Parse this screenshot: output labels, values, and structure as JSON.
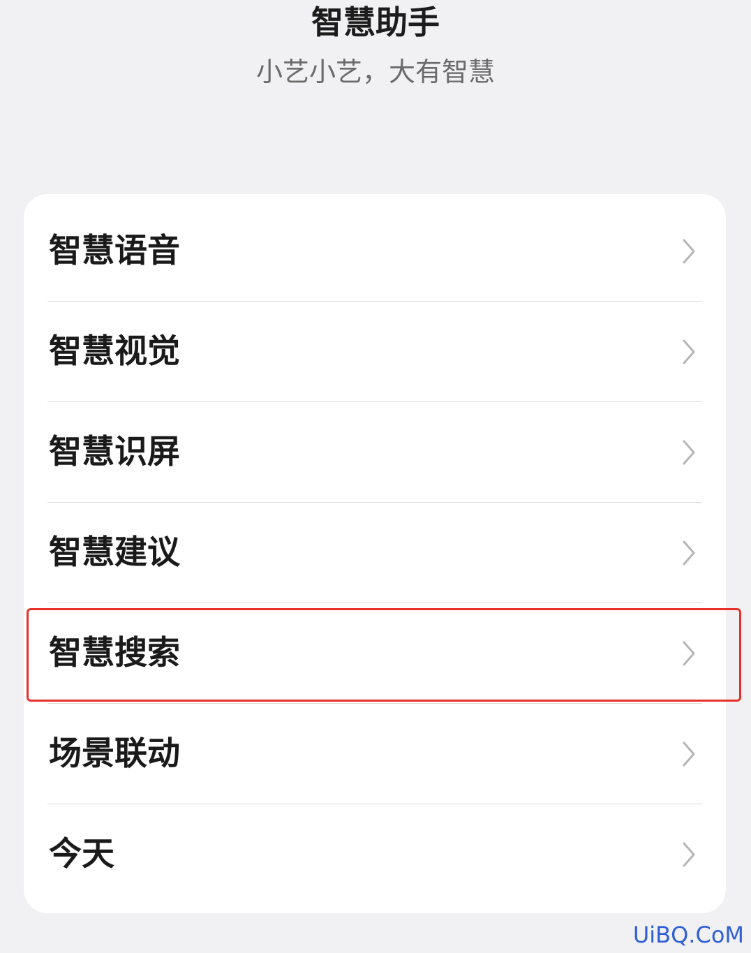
{
  "header": {
    "title": "智慧助手",
    "subtitle": "小艺小艺，大有智慧"
  },
  "menu": {
    "items": [
      {
        "label": "智慧语音",
        "icon": "chevron-right-icon"
      },
      {
        "label": "智慧视觉",
        "icon": "chevron-right-icon"
      },
      {
        "label": "智慧识屏",
        "icon": "chevron-right-icon"
      },
      {
        "label": "智慧建议",
        "icon": "chevron-right-icon"
      },
      {
        "label": "智慧搜索",
        "icon": "chevron-right-icon",
        "highlighted": true
      },
      {
        "label": "场景联动",
        "icon": "chevron-right-icon"
      },
      {
        "label": "今天",
        "icon": "chevron-right-icon"
      }
    ]
  },
  "annotation": {
    "highlight_color": "#e8302b"
  },
  "watermark": {
    "text": "UiBQ.CoM",
    "color": "#2f5fd6"
  },
  "colors": {
    "background": "#f1f1f3",
    "card": "#ffffff",
    "chevron": "#b5b5b5"
  }
}
